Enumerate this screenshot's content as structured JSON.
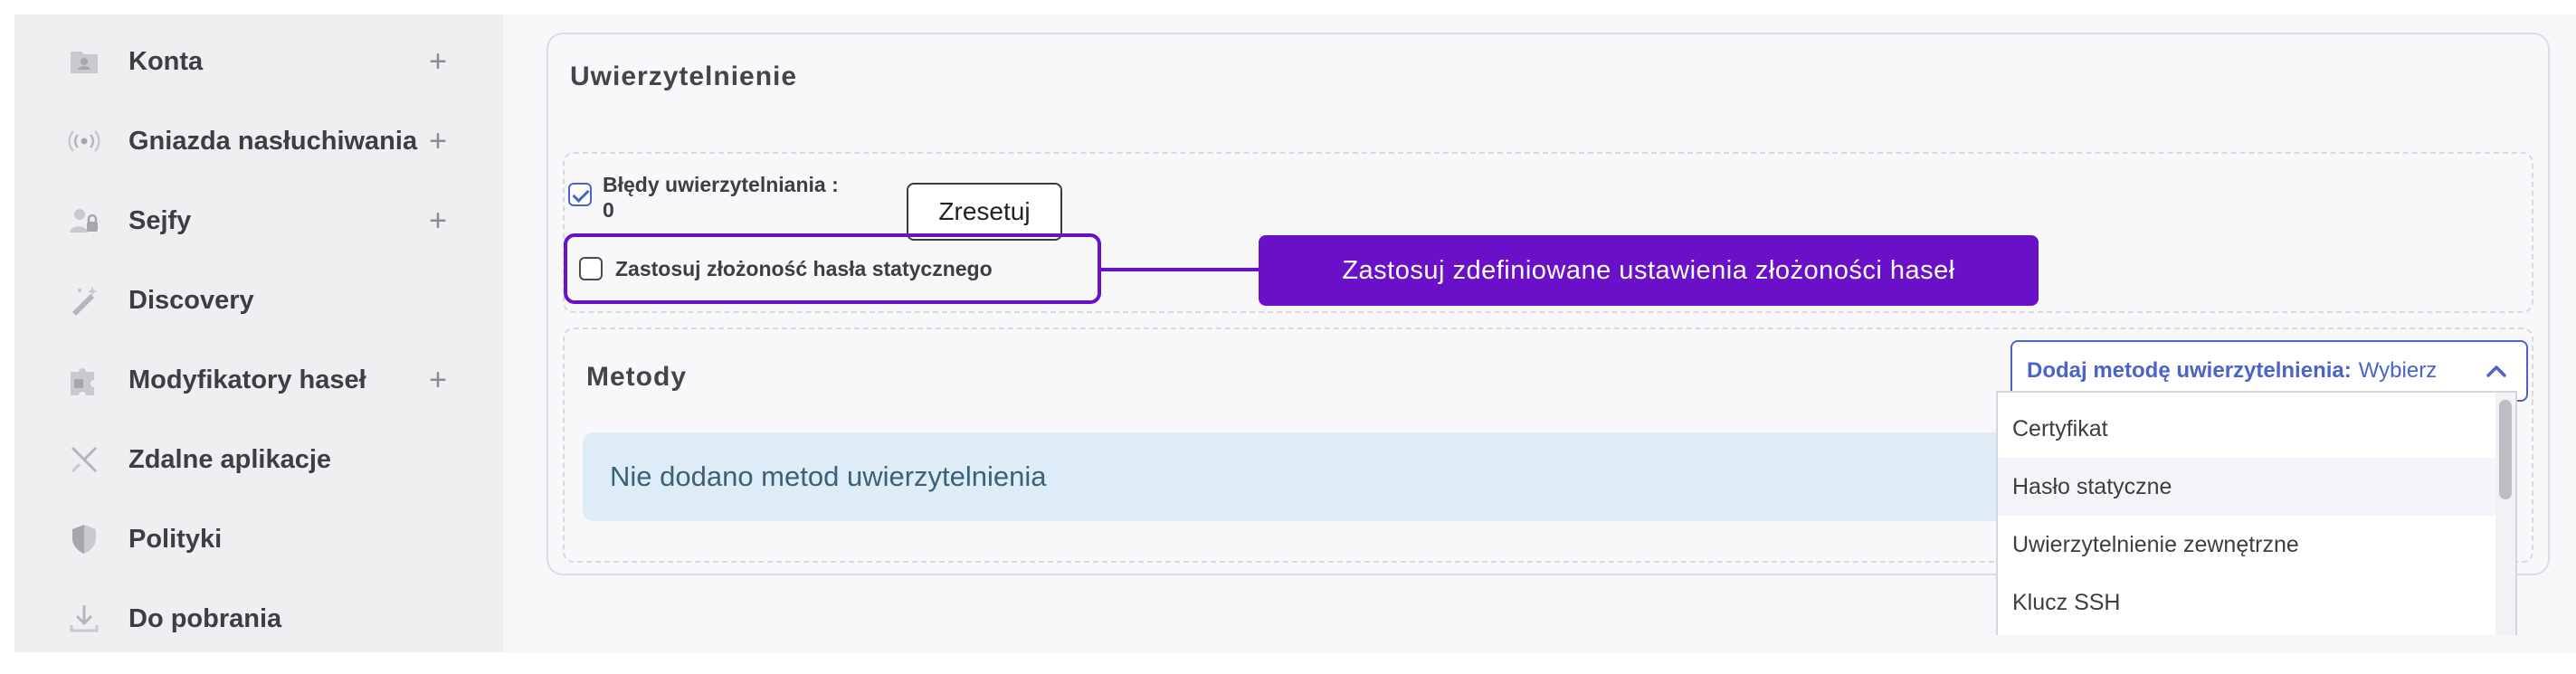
{
  "sidebar": {
    "items": [
      {
        "label": "Konta",
        "icon": "account-icon",
        "expandable": true
      },
      {
        "label": "Gniazda nasłuchiwania",
        "icon": "listener-icon",
        "expandable": true
      },
      {
        "label": "Sejfy",
        "icon": "vault-user-icon",
        "expandable": true
      },
      {
        "label": "Discovery",
        "icon": "magic-wand-icon",
        "expandable": false
      },
      {
        "label": "Modyfikatory haseł",
        "icon": "puzzle-icon",
        "expandable": true
      },
      {
        "label": "Zdalne aplikacje",
        "icon": "remote-app-icon",
        "expandable": false
      },
      {
        "label": "Polityki",
        "icon": "shield-icon",
        "expandable": false
      },
      {
        "label": "Do pobrania",
        "icon": "download-icon",
        "expandable": false
      }
    ],
    "plus_glyph": "+"
  },
  "auth": {
    "title": "Uwierzytelnienie",
    "errors_label_line1": "Błędy uwierzytelniania :",
    "errors_label_line2": "0",
    "errors_checked": true,
    "reset_label": "Zresetuj",
    "complexity_label": "Zastosuj złożoność hasła statycznego",
    "complexity_checked": false,
    "tooltip": "Zastosuj zdefiniowane ustawienia złożoności haseł"
  },
  "methods": {
    "title": "Metody",
    "empty_message": "Nie dodano metod uwierzytelnienia",
    "add_label": "Dodaj metodę uwierzytelnienia:",
    "add_value": "Wybierz",
    "options": [
      "Certyfikat",
      "Hasło statyczne",
      "Uwierzytelnienie zewnętrzne",
      "Klucz SSH"
    ],
    "hovered_option": "Hasło statyczne"
  },
  "colors": {
    "accent": "#4c63c8",
    "highlight": "#6a10c8",
    "info_bg": "#ddecf6"
  }
}
